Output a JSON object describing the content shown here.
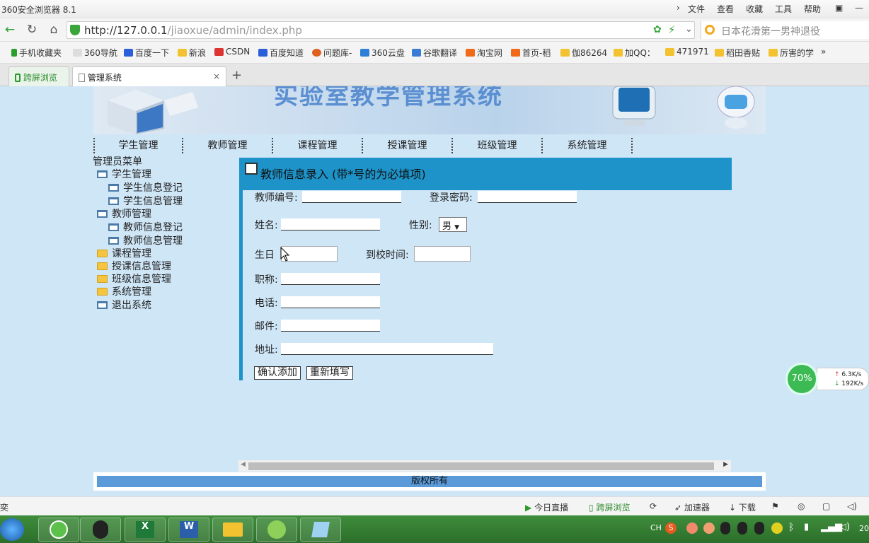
{
  "browser": {
    "title": "360安全浏览器 8.1",
    "menu": [
      "文件",
      "查看",
      "收藏",
      "工具",
      "帮助"
    ],
    "url_host": "http://127.0.0.1",
    "url_path": "/jiaoxue/admin/index.php",
    "search_text": "日本花滑第一男神退役"
  },
  "bookmarks": [
    {
      "label": "手机收藏夹",
      "color": "#2aa02a"
    },
    {
      "label": "360导航",
      "color": "#bbb"
    },
    {
      "label": "百度一下",
      "color": "#2b5fd9"
    },
    {
      "label": "新浪",
      "color": "#f2c230"
    },
    {
      "label": "CSDN",
      "color": "#d33"
    },
    {
      "label": "百度知道",
      "color": "#2b5fd9"
    },
    {
      "label": "问题库-",
      "color": "#e06020"
    },
    {
      "label": "360云盘",
      "color": "#2f7ed8"
    },
    {
      "label": "谷歌翻译",
      "color": "#3a7bd5"
    },
    {
      "label": "淘宝网",
      "color": "#f06a1a"
    },
    {
      "label": "首页-稻",
      "color": "#f06a1a"
    },
    {
      "label": "伽86264",
      "color": "#f2c230"
    },
    {
      "label": "加QQ：",
      "color": "#f2c230"
    },
    {
      "label": "471971",
      "color": "#f2c230"
    },
    {
      "label": "稻田香贴",
      "color": "#f2c230"
    },
    {
      "label": "厉害的学",
      "color": "#f2c230"
    }
  ],
  "tabs": [
    {
      "label": "跨屏浏览"
    },
    {
      "label": "管理系统"
    }
  ],
  "page": {
    "banner_title": "实验室教学管理系统",
    "topnav": [
      "学生管理",
      "教师管理",
      "课程管理",
      "授课管理",
      "班级管理",
      "系统管理"
    ],
    "sidemenu_title": "管理员菜单",
    "sidemenu": [
      {
        "label": "学生管理",
        "icon": "window-icon",
        "level": 0
      },
      {
        "label": "学生信息登记",
        "icon": "window-icon",
        "level": 1
      },
      {
        "label": "学生信息管理",
        "icon": "window-icon",
        "level": 1
      },
      {
        "label": "教师管理",
        "icon": "window-icon",
        "level": 0
      },
      {
        "label": "教师信息登记",
        "icon": "window-icon",
        "level": 1
      },
      {
        "label": "教师信息管理",
        "icon": "window-icon",
        "level": 1
      },
      {
        "label": "课程管理",
        "icon": "folder-icon",
        "level": 0
      },
      {
        "label": "授课信息管理",
        "icon": "folder-icon",
        "level": 0
      },
      {
        "label": "班级信息管理",
        "icon": "folder-icon",
        "level": 0
      },
      {
        "label": "系统管理",
        "icon": "folder-icon",
        "level": 0
      },
      {
        "label": "退出系统",
        "icon": "window-icon",
        "level": 0
      }
    ],
    "form": {
      "title": "教师信息录入 (带*号的为必填项)",
      "teacher_no": "教师编号:",
      "password": "登录密码:",
      "name": "姓名:",
      "gender": "性别:",
      "gender_value": "男",
      "birthday": "生日",
      "arrival": "到校时间:",
      "title_field": "职称:",
      "phone": "电话:",
      "email": "邮件:",
      "address": "地址:",
      "submit": "确认添加",
      "reset": "重新填写"
    },
    "footer": "版权所有"
  },
  "statusbar": {
    "left": "奕",
    "items": [
      "今日直播",
      "跨屏浏览",
      "加速器",
      "下载"
    ]
  },
  "speed": {
    "percent": "70%",
    "up": "6.3K/s",
    "down": "192K/s"
  },
  "tray": {
    "lang": "CH",
    "clock": "20"
  }
}
